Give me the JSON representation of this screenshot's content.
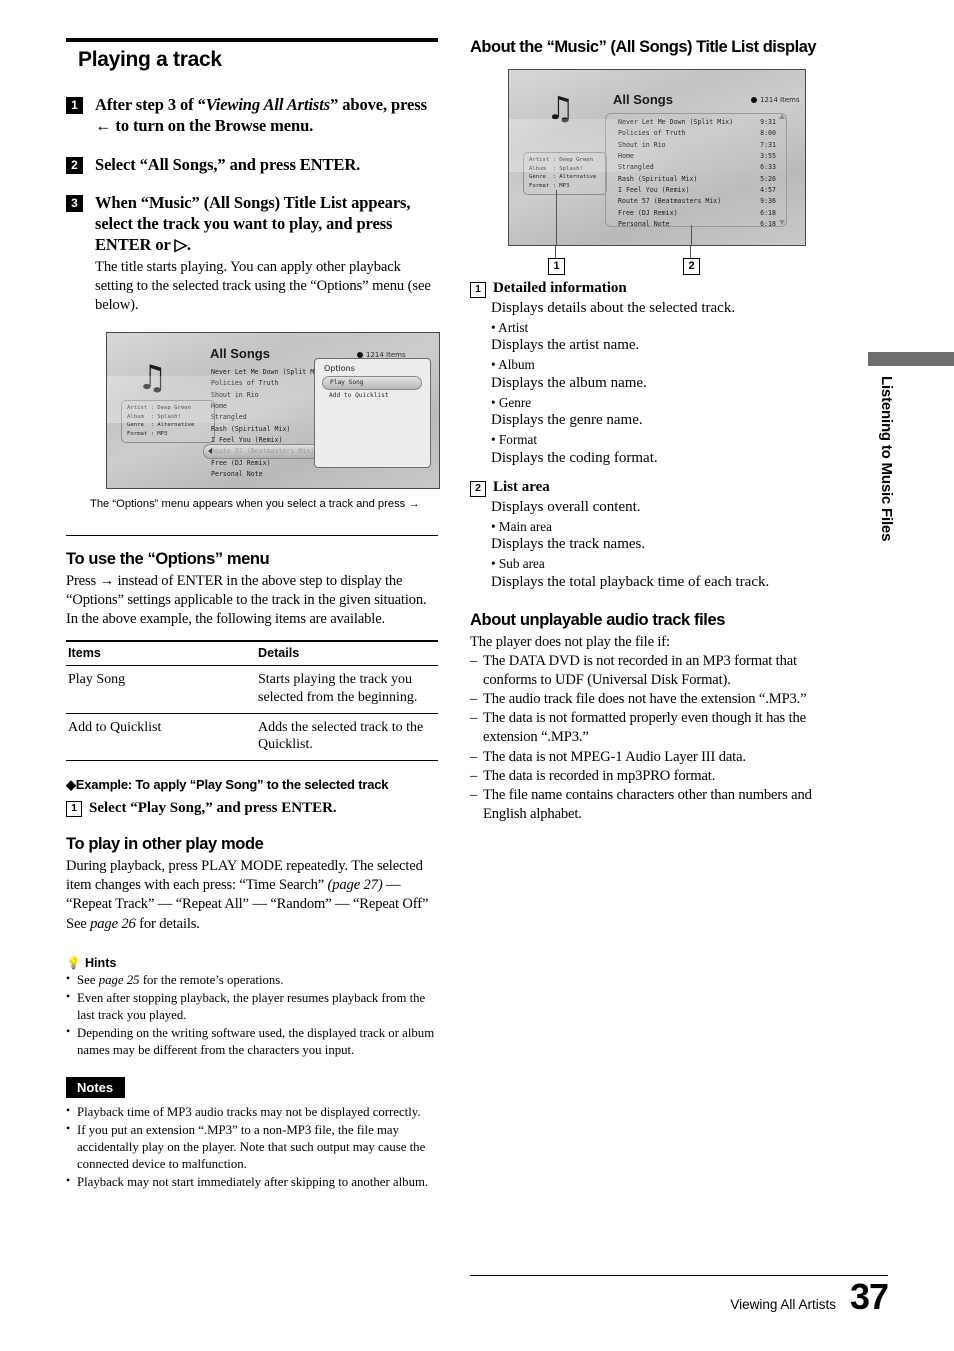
{
  "page": {
    "number": "37",
    "footer_label": "Viewing All Artists",
    "side_tab": "Listening to Music Files"
  },
  "left": {
    "title": "Playing a track",
    "steps": [
      {
        "num": "1",
        "lead_a": "After step 3 of “",
        "lead_italic": "Viewing All Artists",
        "lead_b": "” above, press ",
        "lead_arrow": "←",
        "lead_c": " to turn on the Browse menu."
      },
      {
        "num": "2",
        "lead": "Select “All Songs,” and press ENTER."
      },
      {
        "num": "3",
        "lead": "When “Music” (All Songs) Title List appears, select the track you want to play, and press ENTER or ▷.",
        "sub": "The title starts playing. You can apply other playback setting to the selected track using the “Options” menu (see below)."
      }
    ],
    "figure1": {
      "title": "All Songs",
      "items_count": "1214 Items",
      "note_icon": "music-note-icon",
      "info": "Artist : Deep Green\nAlbum  : Splash!\nGenre  : Alternative\nFormat : MP3",
      "tracks": [
        "Never Let Me Down (Split Mix)",
        "Policies of Truth",
        "Shout in Rio",
        "Home",
        "Strangled",
        "Rash (Spiritual Mix)",
        "I Feel You (Remix)",
        "Route 57 (Beatmasters Mix)",
        "Free (DJ Remix)",
        "Personal Note"
      ],
      "selected_track": "I Feel You (Remix)",
      "options_panel": {
        "title": "Options",
        "items": [
          "Play Song",
          "Add to Quicklist"
        ],
        "selected": "Play Song"
      },
      "caption": "The “Options” menu appears when you select a track and press →"
    },
    "options_menu": {
      "heading": "To use the “Options” menu",
      "intro_a": "Press ",
      "intro_arrow": "→",
      "intro_b": " instead of ENTER in the above step to display the “Options” settings applicable to the track in the given situation. In the above example, the following items are available.",
      "table": {
        "headers": [
          "Items",
          "Details"
        ],
        "rows": [
          [
            "Play Song",
            "Starts playing the track you selected from the beginning."
          ],
          [
            "Add to Quicklist",
            "Adds the selected track to the Quicklist."
          ]
        ]
      },
      "example_title": "◆Example: To apply “Play Song” to the selected track",
      "example_step_num": "1",
      "example_step": "Select “Play Song,” and press ENTER."
    },
    "play_mode": {
      "heading": "To play in other play mode",
      "body_a": "During playback, press PLAY MODE repeatedly. The selected item changes with each press: “Time Search” ",
      "body_page1": "(page 27)",
      "body_b": " — “Repeat Track” — “Repeat All” — “Random” — “Repeat Off” See ",
      "body_page2": "page 26",
      "body_c": " for details."
    },
    "hints": {
      "heading": "Hints",
      "icon": "lightbulb-icon",
      "items": [
        {
          "a": "See ",
          "i": "page 25",
          "b": " for the remote’s operations."
        },
        {
          "a": "Even after stopping playback, the player resumes playback from the last track you played.",
          "i": "",
          "b": ""
        },
        {
          "a": "Depending on the writing software used, the displayed track or album names may be different from the characters you input.",
          "i": "",
          "b": ""
        }
      ]
    },
    "notes": {
      "badge": "Notes",
      "items": [
        "Playback time of MP3 audio tracks may not be displayed correctly.",
        "If you put an extension “.MP3” to a non-MP3 file, the file may accidentally play on the player. Note that such output may cause the connected device to malfunction.",
        "Playback may not start immediately after skipping to another album."
      ]
    }
  },
  "right": {
    "title": "About the “Music” (All Songs) Title List display",
    "figure2": {
      "title": "All Songs",
      "items_count": "1214 Items",
      "note_icon": "music-note-icon",
      "info": "Artist : Deep Green\nAlbum  : Splash!\nGenre  : Alternative\nFormat : MP3",
      "tracks": [
        {
          "name": "Never Let Me Down (Split Mix)",
          "time": "9:31"
        },
        {
          "name": "Policies of Truth",
          "time": "8:00"
        },
        {
          "name": "Shout in Rio",
          "time": "7:31"
        },
        {
          "name": "Home",
          "time": "3:55"
        },
        {
          "name": "Strangled",
          "time": "6:33"
        },
        {
          "name": "Rash (Spiritual Mix)",
          "time": "5:26"
        },
        {
          "name": "I Feel You (Remix)",
          "time": "4:57"
        },
        {
          "name": "Route 57 (Beatmasters Mix)",
          "time": "9:36"
        },
        {
          "name": "Free (DJ Remix)",
          "time": "6:18"
        },
        {
          "name": "Personal Note",
          "time": "6:18"
        }
      ],
      "callout_1": "1",
      "callout_2": "2"
    },
    "legend": [
      {
        "num": "1",
        "heading": "Detailed information",
        "lines": [
          "Displays details about the selected track.",
          "• Artist",
          "Displays the artist name.",
          "• Album",
          "Displays the album name.",
          "• Genre",
          "Displays the genre name.",
          "• Format",
          "Displays the coding format."
        ]
      },
      {
        "num": "2",
        "heading": "List area",
        "lines": [
          "Displays overall content.",
          "• Main area",
          "Displays the track names.",
          "• Sub area",
          "Displays the total playback time of each track."
        ]
      }
    ],
    "unplayable": {
      "heading": "About unplayable audio track files",
      "intro": "The player does not play the file if:",
      "items": [
        "The DATA DVD is not recorded in an MP3 format that conforms to UDF (Universal Disk Format).",
        "The audio track file does not have the extension “.MP3.”",
        "The data is not formatted properly even though it has the extension “.MP3.”",
        "The data is not MPEG-1 Audio Layer III data.",
        "The data is recorded in mp3PRO format.",
        "The file name contains characters other than numbers and English alphabet."
      ]
    }
  }
}
